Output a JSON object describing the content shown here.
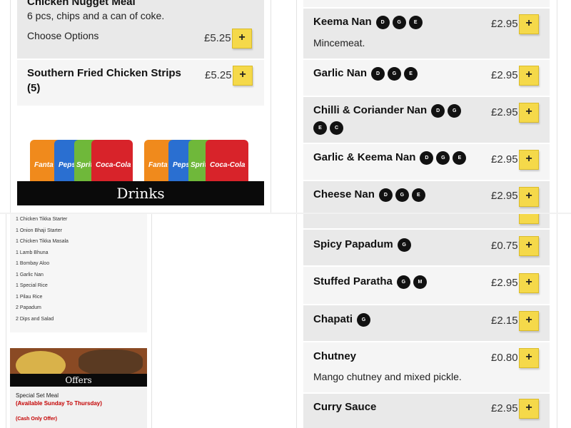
{
  "left_column": {
    "items": [
      {
        "name": "Chicken Nugget Meal",
        "description": "6 pcs, chips and a can of coke.",
        "options_label": "Choose Options",
        "price": "£5.25",
        "add_label": "+"
      },
      {
        "name": "Southern Fried Chicken Strips",
        "name_line2": "(5)",
        "price": "£5.25",
        "add_label": "+"
      }
    ],
    "drinks_banner": {
      "title": "Drinks",
      "can_labels": [
        "Fanta",
        "Pepsi",
        "Sprite",
        "Coca-Cola",
        "Fanta",
        "Pepsi",
        "Sprite",
        "Coca-Cola"
      ]
    }
  },
  "set_meal_list": [
    "1 Chicken Tikka Starter",
    "1 Onion Bhaji Starter",
    "1 Chicken Tikka Masala",
    "1 Lamb Bhuna",
    "1 Bombay Aloo",
    "1 Garlic Nan",
    "1 Special Rice",
    "1 Pilau Rice",
    "2 Papadum",
    "2 Dips and Salad"
  ],
  "offers": {
    "title": "Offers",
    "line1": "Special Set Meal",
    "line2": "(Available Sunday To Thursday)",
    "line3": "(Cash Only Offer)"
  },
  "right_column": {
    "items": [
      {
        "name": "Keema Nan",
        "badges": [
          "D",
          "G",
          "E"
        ],
        "description": "Mincemeat.",
        "price": "£2.95",
        "add_label": "+"
      },
      {
        "name": "Garlic Nan",
        "badges": [
          "D",
          "G",
          "E"
        ],
        "price": "£2.95",
        "add_label": "+"
      },
      {
        "name": "Chilli & Coriander Nan",
        "badges": [
          "D",
          "G"
        ],
        "badges_line2": [
          "E",
          "C"
        ],
        "price": "£2.95",
        "add_label": "+"
      },
      {
        "name": "Garlic & Keema Nan",
        "badges": [
          "D",
          "G",
          "E"
        ],
        "price": "£2.95",
        "add_label": "+"
      },
      {
        "name": "Cheese Nan",
        "badges": [
          "D",
          "G",
          "E"
        ],
        "price": "£2.95",
        "add_label": "+"
      },
      {
        "name": "Spicy Papadum",
        "badges": [
          "G"
        ],
        "price": "£0.75",
        "add_label": "+"
      },
      {
        "name": "Stuffed Paratha",
        "badges": [
          "G",
          "M"
        ],
        "price": "£2.95",
        "add_label": "+"
      },
      {
        "name": "Chapati",
        "badges": [
          "G"
        ],
        "price": "£2.15",
        "add_label": "+"
      },
      {
        "name": "Chutney",
        "badges": [],
        "description": "Mango chutney and mixed pickle.",
        "price": "£0.80",
        "add_label": "+"
      },
      {
        "name": "Curry Sauce",
        "badges": [],
        "price": "£2.95",
        "add_label": "+"
      }
    ]
  },
  "colors": {
    "add_button": "#f5d94a",
    "item_grey": "#e9e9e9",
    "item_light": "#f5f5f5",
    "banner_bar": "#0a0a0a",
    "offer_red": "#c40000"
  }
}
